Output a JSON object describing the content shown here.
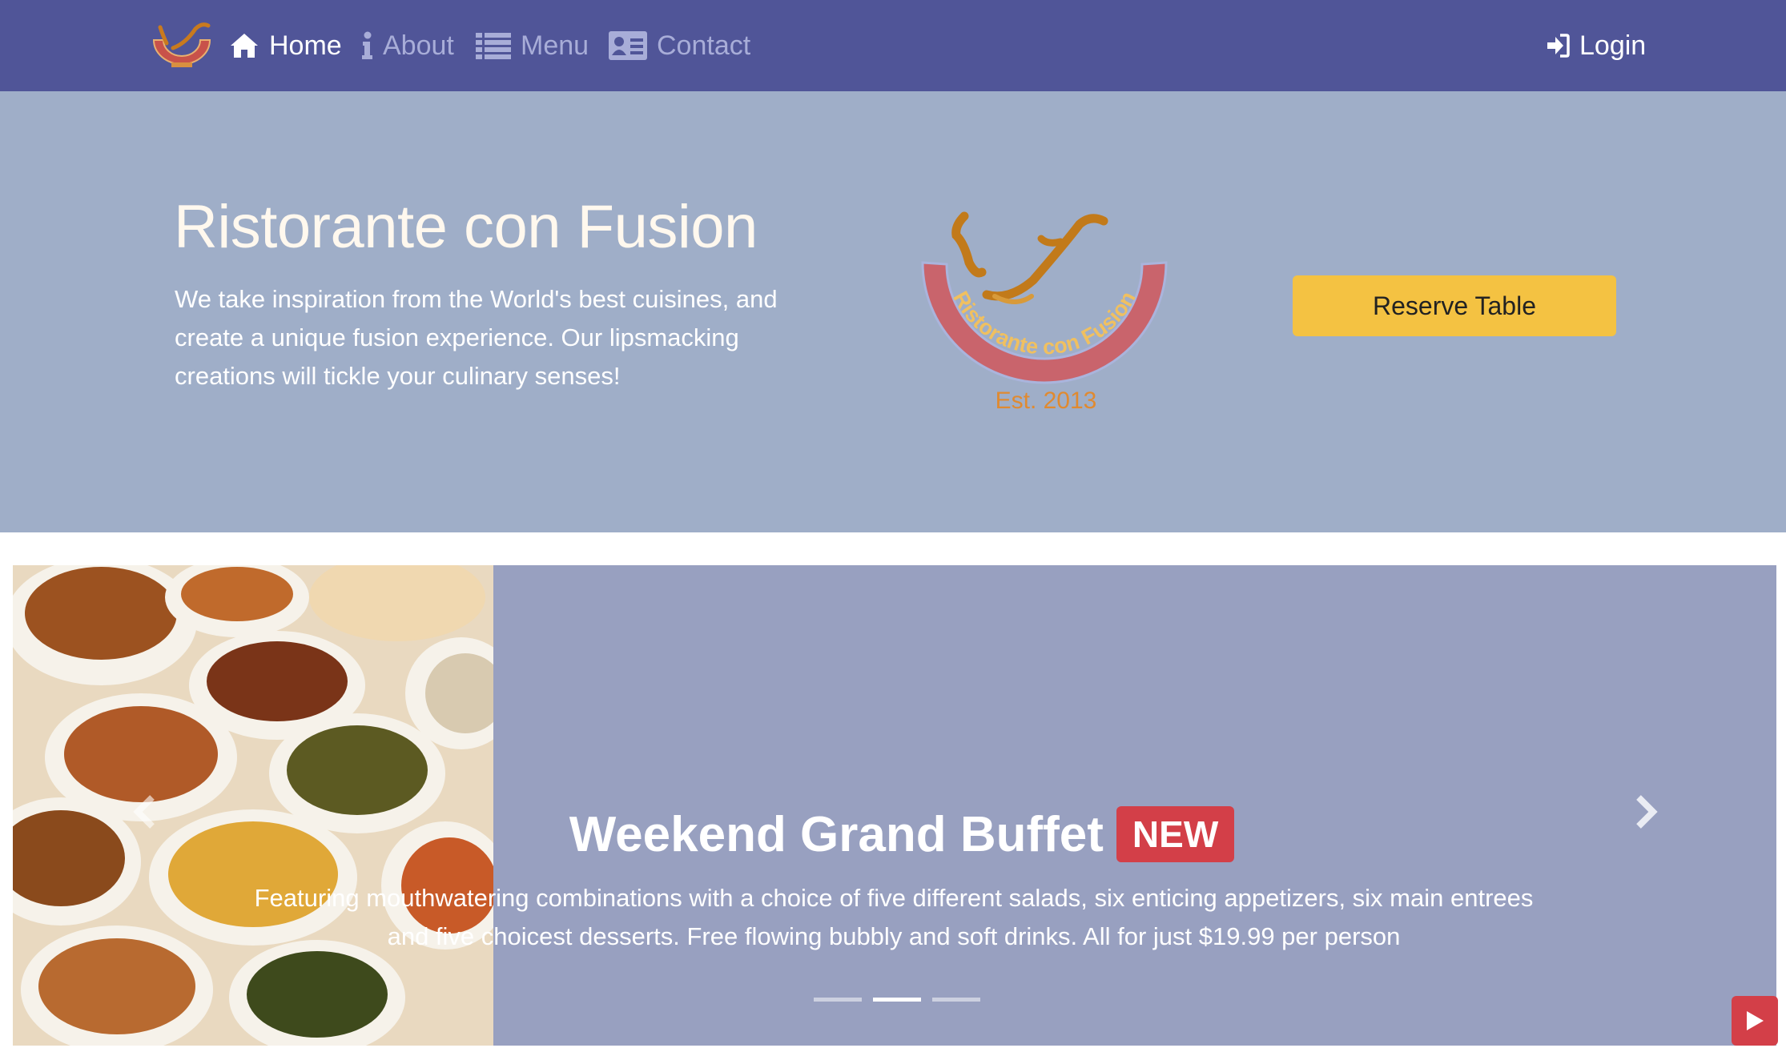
{
  "navbar": {
    "brand_logo": "ristorante-logo",
    "items": [
      {
        "label": "Home",
        "icon": "home-icon",
        "active": true
      },
      {
        "label": "About",
        "icon": "info-icon",
        "active": false
      },
      {
        "label": "Menu",
        "icon": "list-icon",
        "active": false
      },
      {
        "label": "Contact",
        "icon": "address-card-icon",
        "active": false
      }
    ],
    "login": {
      "label": "Login",
      "icon": "sign-in-icon"
    }
  },
  "jumbotron": {
    "title": "Ristorante con Fusion",
    "text": "We take inspiration from the World's best cuisines, and create a unique fusion experience. Our lipsmacking creations will tickle your culinary senses!",
    "logo": {
      "arc_text": "Ristorante con Fusion",
      "est_text": "Est. 2013"
    },
    "reserve_button": "Reserve Table"
  },
  "carousel": {
    "slide": {
      "image": "buffet-dishes-photo",
      "title": "Weekend Grand Buffet",
      "badge": "NEW",
      "description": "Featuring mouthwatering combinations with a choice of five different salads, six enticing appetizers, six main entrees and five choicest desserts. Free flowing bubbly and soft drinks. All for just $19.99 per person"
    },
    "indicators": [
      false,
      true,
      false
    ],
    "controls": {
      "prev_icon": "chevron-left-icon",
      "next_icon": "chevron-right-icon",
      "play_icon": "play-icon"
    }
  },
  "colors": {
    "navbar": "#505598",
    "jumbotron": "#9faec8",
    "carousel": "#98a0c0",
    "reserve_button": "#f4c242",
    "badge": "#d33f48"
  }
}
